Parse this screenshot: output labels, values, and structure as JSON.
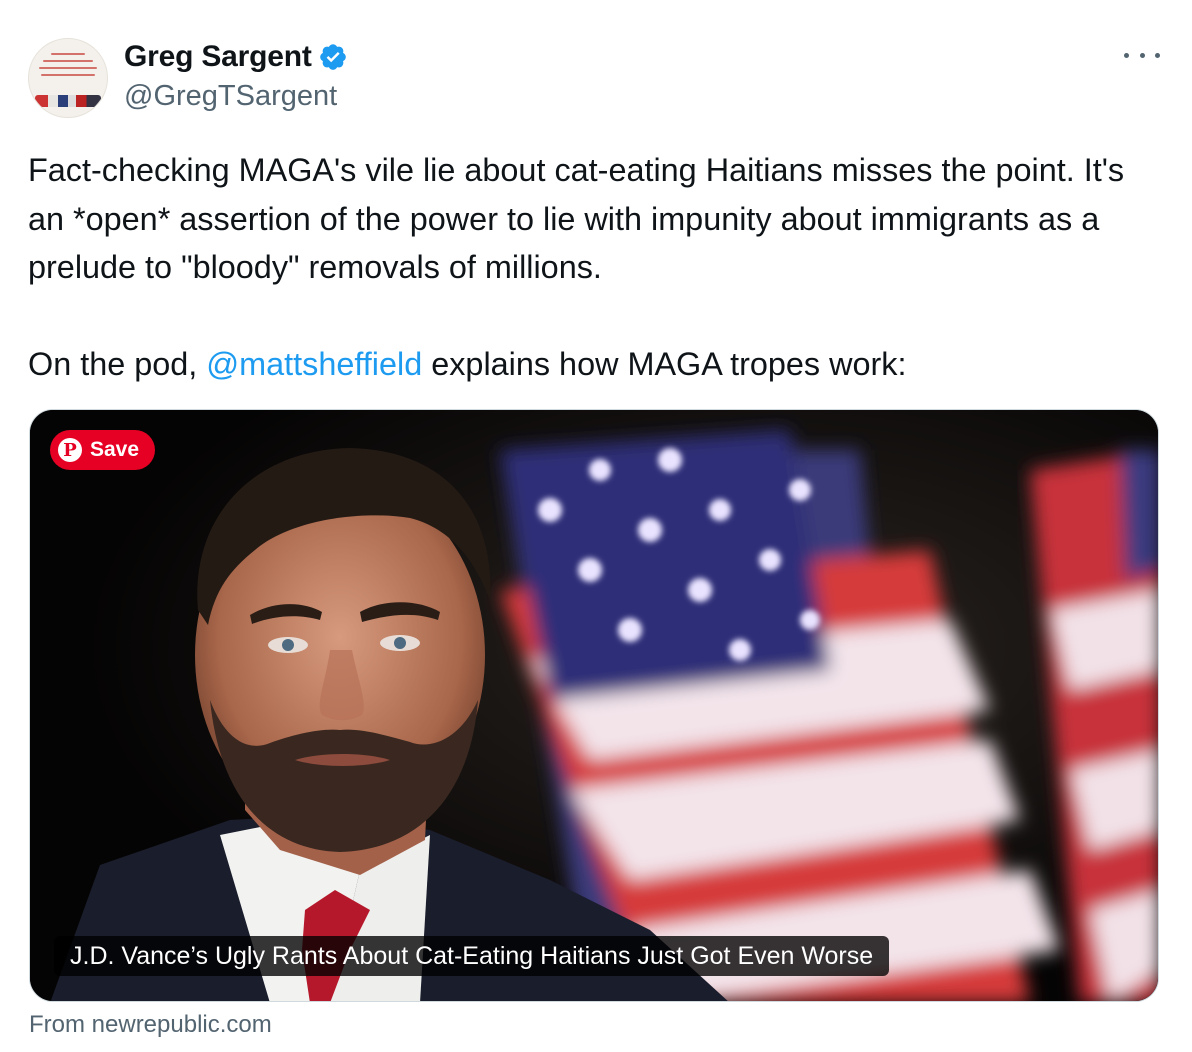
{
  "author": {
    "name": "Greg Sargent",
    "handle": "@GregTSargent",
    "avatar_text": "TAKING BACK OUR DEMOCRACY IN AN AGE OF TRUMPIAN DISINFORMATION AND THUNDERDOME POLITICS"
  },
  "tweet": {
    "paragraph1": "Fact-checking MAGA's vile lie about cat-eating Haitians misses the point. It's an *open* assertion of the power to lie with impunity about immigrants as a prelude to \"bloody\" removals of millions.",
    "paragraph2_prefix": "On the pod, ",
    "mention": "@mattsheffield",
    "paragraph2_suffix": " explains how MAGA tropes work:"
  },
  "card": {
    "save_label": "Save",
    "caption": "J.D. Vance’s Ugly Rants About Cat-Eating Haitians Just Got Even Worse",
    "source": "From newrepublic.com"
  },
  "icons": {
    "verified": "verified-badge-icon",
    "more": "more-icon",
    "pinterest": "pinterest-icon"
  },
  "colors": {
    "link": "#1d9bf0",
    "verified": "#1d9bf0",
    "secondary_text": "#536471",
    "pinterest_red": "#e60023"
  }
}
